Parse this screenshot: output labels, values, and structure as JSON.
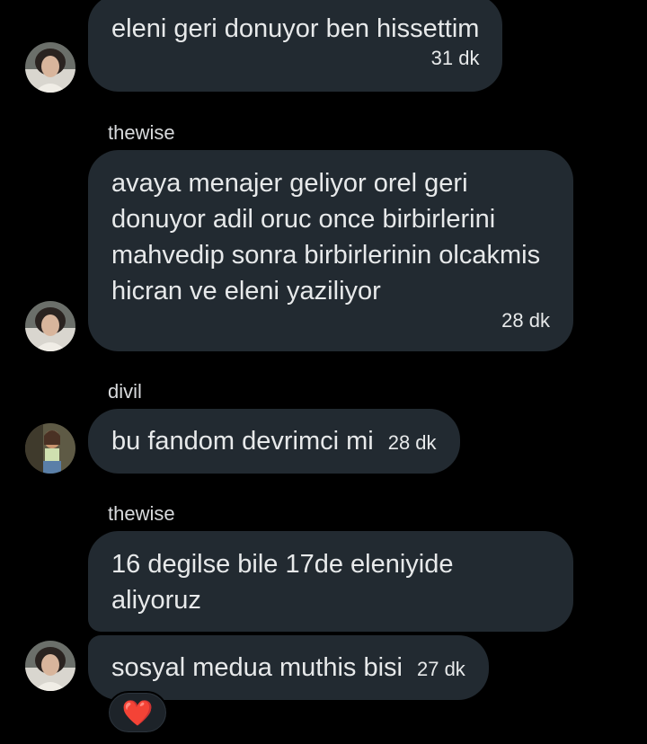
{
  "messages": [
    {
      "text": "eleni geri donuyor ben hissettim",
      "time": "31 dk"
    },
    {
      "sender": "thewise",
      "text": "avaya menajer geliyor orel geri donuyor adil oruc once birbirlerini mahvedip sonra birbirlerinin olcakmis hicran ve eleni yaziliyor",
      "time": "28 dk"
    },
    {
      "sender": "divil",
      "text": "bu fandom devrimci mi",
      "time": "28 dk"
    },
    {
      "sender": "thewise",
      "text": "16 degilse bile 17de eleniyide aliyoruz"
    },
    {
      "text": "sosyal medua muthis bisi",
      "time": "27 dk",
      "reaction": "❤️"
    }
  ],
  "colors": {
    "background": "#000000",
    "bubble": "#222a31",
    "text": "#e7e9ea",
    "heart": "#e0263c"
  }
}
